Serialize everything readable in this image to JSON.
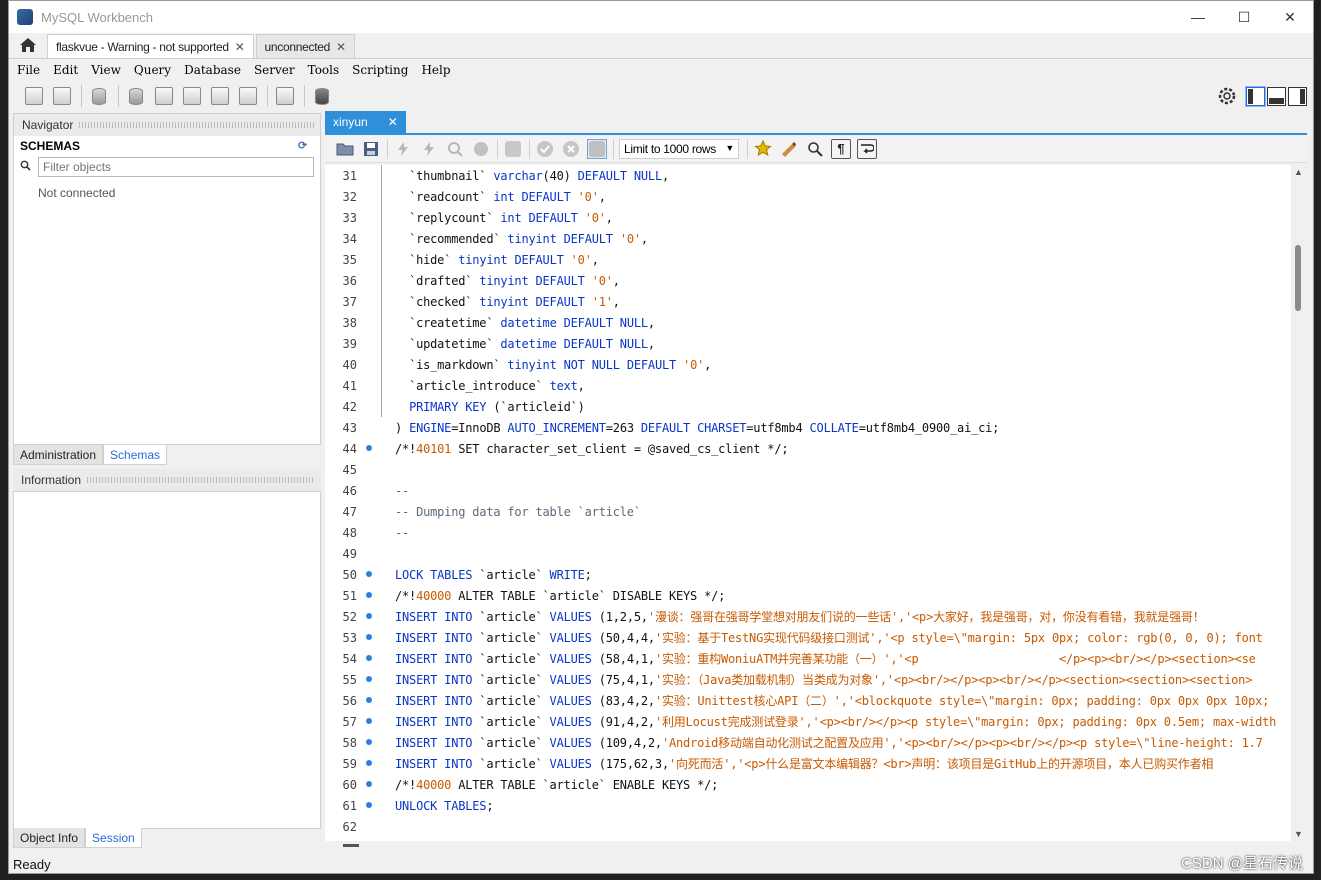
{
  "window": {
    "title": "MySQL Workbench",
    "minimize": "—",
    "maximize": "☐",
    "close": "✕"
  },
  "conn_tabs": [
    {
      "label": "flaskvue - Warning - not supported",
      "close": "✕"
    },
    {
      "label": "unconnected",
      "close": "✕"
    }
  ],
  "menu": [
    "File",
    "Edit",
    "View",
    "Query",
    "Database",
    "Server",
    "Tools",
    "Scripting",
    "Help"
  ],
  "navigator": {
    "header": "Navigator",
    "schemas_title": "SCHEMAS",
    "filter_placeholder": "Filter objects",
    "status": "Not connected",
    "tabs": [
      "Administration",
      "Schemas"
    ]
  },
  "information": {
    "header": "Information",
    "tabs": [
      "Object Info",
      "Session"
    ]
  },
  "editor": {
    "tab_label": "xinyun",
    "tab_close": "✕",
    "limit_label": "Limit to 1000 rows"
  },
  "code_lines": [
    {
      "n": "31",
      "dot": false,
      "bar": true,
      "indent": "  ",
      "parts": [
        [
          "t",
          "`thumbnail` "
        ],
        [
          "k",
          "varchar"
        ],
        [
          "t",
          "(40) "
        ],
        [
          "k",
          "DEFAULT NULL"
        ],
        [
          "t",
          ","
        ]
      ]
    },
    {
      "n": "32",
      "dot": false,
      "bar": true,
      "indent": "  ",
      "parts": [
        [
          "t",
          "`readcount` "
        ],
        [
          "k",
          "int DEFAULT "
        ],
        [
          "s",
          "'0'"
        ],
        [
          "t",
          ","
        ]
      ]
    },
    {
      "n": "33",
      "dot": false,
      "bar": true,
      "indent": "  ",
      "parts": [
        [
          "t",
          "`replycount` "
        ],
        [
          "k",
          "int DEFAULT "
        ],
        [
          "s",
          "'0'"
        ],
        [
          "t",
          ","
        ]
      ]
    },
    {
      "n": "34",
      "dot": false,
      "bar": true,
      "indent": "  ",
      "parts": [
        [
          "t",
          "`recommended` "
        ],
        [
          "k",
          "tinyint DEFAULT "
        ],
        [
          "s",
          "'0'"
        ],
        [
          "t",
          ","
        ]
      ]
    },
    {
      "n": "35",
      "dot": false,
      "bar": true,
      "indent": "  ",
      "parts": [
        [
          "t",
          "`hide` "
        ],
        [
          "k",
          "tinyint DEFAULT "
        ],
        [
          "s",
          "'0'"
        ],
        [
          "t",
          ","
        ]
      ]
    },
    {
      "n": "36",
      "dot": false,
      "bar": true,
      "indent": "  ",
      "parts": [
        [
          "t",
          "`drafted` "
        ],
        [
          "k",
          "tinyint DEFAULT "
        ],
        [
          "s",
          "'0'"
        ],
        [
          "t",
          ","
        ]
      ]
    },
    {
      "n": "37",
      "dot": false,
      "bar": true,
      "indent": "  ",
      "parts": [
        [
          "t",
          "`checked` "
        ],
        [
          "k",
          "tinyint DEFAULT "
        ],
        [
          "s",
          "'1'"
        ],
        [
          "t",
          ","
        ]
      ]
    },
    {
      "n": "38",
      "dot": false,
      "bar": true,
      "indent": "  ",
      "parts": [
        [
          "t",
          "`createtime` "
        ],
        [
          "k",
          "datetime DEFAULT NULL"
        ],
        [
          "t",
          ","
        ]
      ]
    },
    {
      "n": "39",
      "dot": false,
      "bar": true,
      "indent": "  ",
      "parts": [
        [
          "t",
          "`updatetime` "
        ],
        [
          "k",
          "datetime DEFAULT NULL"
        ],
        [
          "t",
          ","
        ]
      ]
    },
    {
      "n": "40",
      "dot": false,
      "bar": true,
      "indent": "  ",
      "parts": [
        [
          "t",
          "`is_markdown` "
        ],
        [
          "k",
          "tinyint NOT NULL DEFAULT "
        ],
        [
          "s",
          "'0'"
        ],
        [
          "t",
          ","
        ]
      ]
    },
    {
      "n": "41",
      "dot": false,
      "bar": true,
      "indent": "  ",
      "parts": [
        [
          "t",
          "`article_introduce` "
        ],
        [
          "k",
          "text"
        ],
        [
          "t",
          ","
        ]
      ]
    },
    {
      "n": "42",
      "dot": false,
      "bar": true,
      "indent": "  ",
      "parts": [
        [
          "k",
          "PRIMARY KEY "
        ],
        [
          "t",
          "(`articleid`)"
        ]
      ]
    },
    {
      "n": "43",
      "dot": false,
      "bar": false,
      "indent": "",
      "parts": [
        [
          "t",
          ") "
        ],
        [
          "k",
          "ENGINE"
        ],
        [
          "t",
          "=InnoDB "
        ],
        [
          "k",
          "AUTO_INCREMENT"
        ],
        [
          "t",
          "=263 "
        ],
        [
          "k",
          "DEFAULT CHARSET"
        ],
        [
          "t",
          "=utf8mb4 "
        ],
        [
          "k",
          "COLLATE"
        ],
        [
          "t",
          "=utf8mb4_0900_ai_ci;"
        ]
      ]
    },
    {
      "n": "44",
      "dot": true,
      "bar": false,
      "indent": "",
      "parts": [
        [
          "t",
          "/*!"
        ],
        [
          "s",
          "40101"
        ],
        [
          "t",
          " SET character_set_client = @saved_cs_client */;"
        ]
      ]
    },
    {
      "n": "45",
      "dot": false,
      "bar": false,
      "indent": "",
      "parts": []
    },
    {
      "n": "46",
      "dot": false,
      "bar": false,
      "indent": "",
      "parts": [
        [
          "c",
          "--"
        ]
      ]
    },
    {
      "n": "47",
      "dot": false,
      "bar": false,
      "indent": "",
      "parts": [
        [
          "c",
          "-- Dumping data for table `article`"
        ]
      ]
    },
    {
      "n": "48",
      "dot": false,
      "bar": false,
      "indent": "",
      "parts": [
        [
          "c",
          "--"
        ]
      ]
    },
    {
      "n": "49",
      "dot": false,
      "bar": false,
      "indent": "",
      "parts": []
    },
    {
      "n": "50",
      "dot": true,
      "bar": false,
      "indent": "",
      "parts": [
        [
          "k",
          "LOCK TABLES "
        ],
        [
          "t",
          "`article` "
        ],
        [
          "k",
          "WRITE"
        ],
        [
          "t",
          ";"
        ]
      ]
    },
    {
      "n": "51",
      "dot": true,
      "bar": false,
      "indent": "",
      "parts": [
        [
          "t",
          "/*!"
        ],
        [
          "s",
          "40000"
        ],
        [
          "t",
          " ALTER TABLE `article` DISABLE KEYS */;"
        ]
      ]
    },
    {
      "n": "52",
      "dot": true,
      "bar": false,
      "indent": "",
      "parts": [
        [
          "k",
          "INSERT INTO "
        ],
        [
          "t",
          "`article` "
        ],
        [
          "k",
          "VALUES "
        ],
        [
          "t",
          "(1,2,5,"
        ],
        [
          "s",
          "'漫谈：强哥在强哥学堂想对朋友们说的一些话','<p>大家好，我是强哥，对，你没有看错，我就是强哥！"
        ]
      ]
    },
    {
      "n": "53",
      "dot": true,
      "bar": false,
      "indent": "",
      "parts": [
        [
          "k",
          "INSERT INTO "
        ],
        [
          "t",
          "`article` "
        ],
        [
          "k",
          "VALUES "
        ],
        [
          "t",
          "(50,4,4,"
        ],
        [
          "s",
          "'实验：基于TestNG实现代码级接口测试','<p style=\\\"margin: 5px 0px; color: rgb(0, 0, 0); font"
        ]
      ]
    },
    {
      "n": "54",
      "dot": true,
      "bar": false,
      "indent": "",
      "parts": [
        [
          "k",
          "INSERT INTO "
        ],
        [
          "t",
          "`article` "
        ],
        [
          "k",
          "VALUES "
        ],
        [
          "t",
          "(58,4,1,"
        ],
        [
          "s",
          "'实验：重构WoniuATM并完善某功能（一）','<p                    </p><p><br/></p><section><se"
        ]
      ]
    },
    {
      "n": "55",
      "dot": true,
      "bar": false,
      "indent": "",
      "parts": [
        [
          "k",
          "INSERT INTO "
        ],
        [
          "t",
          "`article` "
        ],
        [
          "k",
          "VALUES "
        ],
        [
          "t",
          "(75,4,1,"
        ],
        [
          "s",
          "'实验：（Java类加载机制）当类成为对象','<p><br/></p><p><br/></p><section><section><section>"
        ]
      ]
    },
    {
      "n": "56",
      "dot": true,
      "bar": false,
      "indent": "",
      "parts": [
        [
          "k",
          "INSERT INTO "
        ],
        [
          "t",
          "`article` "
        ],
        [
          "k",
          "VALUES "
        ],
        [
          "t",
          "(83,4,2,"
        ],
        [
          "s",
          "'实验：Unittest核心API（二）','<blockquote style=\\\"margin: 0px; padding: 0px 0px 0px 10px;"
        ]
      ]
    },
    {
      "n": "57",
      "dot": true,
      "bar": false,
      "indent": "",
      "parts": [
        [
          "k",
          "INSERT INTO "
        ],
        [
          "t",
          "`article` "
        ],
        [
          "k",
          "VALUES "
        ],
        [
          "t",
          "(91,4,2,"
        ],
        [
          "s",
          "'利用Locust完成测试登录','<p><br/></p><p style=\\\"margin: 0px; padding: 0px 0.5em; max-width"
        ]
      ]
    },
    {
      "n": "58",
      "dot": true,
      "bar": false,
      "indent": "",
      "parts": [
        [
          "k",
          "INSERT INTO "
        ],
        [
          "t",
          "`article` "
        ],
        [
          "k",
          "VALUES "
        ],
        [
          "t",
          "(109,4,2,"
        ],
        [
          "s",
          "'Android移动端自动化测试之配置及应用','<p><br/></p><p><br/></p><p style=\\\"line-height: 1.7"
        ]
      ]
    },
    {
      "n": "59",
      "dot": true,
      "bar": false,
      "indent": "",
      "parts": [
        [
          "k",
          "INSERT INTO "
        ],
        [
          "t",
          "`article` "
        ],
        [
          "k",
          "VALUES "
        ],
        [
          "t",
          "(175,62,3,"
        ],
        [
          "s",
          "'向死而活','<p>什么是富文本编辑器？<br>声明：该项目是GitHub上的开源项目，本人已购买作者相"
        ]
      ]
    },
    {
      "n": "60",
      "dot": true,
      "bar": false,
      "indent": "",
      "parts": [
        [
          "t",
          "/*!"
        ],
        [
          "s",
          "40000"
        ],
        [
          "t",
          " ALTER TABLE `article` ENABLE KEYS */;"
        ]
      ]
    },
    {
      "n": "61",
      "dot": true,
      "bar": false,
      "indent": "",
      "parts": [
        [
          "k",
          "UNLOCK TABLES"
        ],
        [
          "t",
          ";"
        ]
      ]
    },
    {
      "n": "62",
      "dot": false,
      "bar": false,
      "indent": "",
      "parts": []
    }
  ],
  "status": "Ready",
  "watermark": "CSDN @星石传说",
  "colors": {
    "accent": "#2f8fd8",
    "keyword": "#0a36c8",
    "string": "#c85a00",
    "comment": "#5b6b7a",
    "gutter_dot": "#2f7fe0"
  }
}
